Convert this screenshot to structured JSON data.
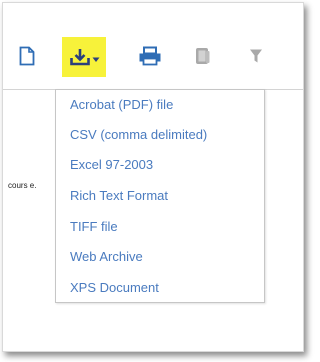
{
  "toolbar": {
    "buttons": [
      {
        "icon": "document-icon"
      },
      {
        "icon": "download-icon",
        "highlight": "#f7f23a",
        "active": true
      },
      {
        "icon": "printer-icon"
      },
      {
        "icon": "copy-icon"
      },
      {
        "icon": "filter-icon"
      }
    ]
  },
  "side_text": "cours e.",
  "export_menu": {
    "items": [
      {
        "label": "Acrobat (PDF) file"
      },
      {
        "label": "CSV (comma delimited)"
      },
      {
        "label": "Excel 97-2003"
      },
      {
        "label": "Rich Text Format"
      },
      {
        "label": "TIFF file"
      },
      {
        "label": "Web Archive"
      },
      {
        "label": "XPS Document"
      }
    ]
  },
  "colors": {
    "icon_blue": "#2f6db5",
    "icon_gray": "#a9a9a9",
    "menu_text": "#4a7bbf",
    "highlight": "#f7f23a"
  }
}
